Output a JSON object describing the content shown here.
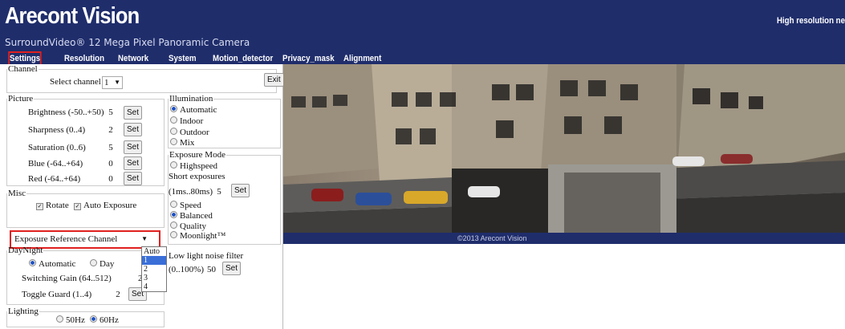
{
  "header": {
    "brand": "Arecont Vision",
    "subtitle": "SurroundVideo® 12 Mega Pixel Panoramic Camera",
    "right_text": "High resolution ne"
  },
  "nav": [
    "Settings",
    "Resolution",
    "Network",
    "System",
    "Motion_detector",
    "Privacy_mask",
    "Alignment"
  ],
  "channel": {
    "legend": "Channel",
    "label": "Select channel",
    "value": "1",
    "exit": "Exit"
  },
  "picture": {
    "legend": "Picture",
    "set": "Set",
    "rows": [
      {
        "label": "Brightness (-50..+50)",
        "value": "5"
      },
      {
        "label": "Sharpness (0..4)",
        "value": "2"
      },
      {
        "label": "Saturation (0..6)",
        "value": "5"
      },
      {
        "label": "Blue (-64..+64)",
        "value": "0"
      },
      {
        "label": "Red (-64..+64)",
        "value": "0"
      }
    ]
  },
  "misc": {
    "legend": "Misc",
    "rotate": "Rotate",
    "auto_exposure": "Auto Exposure",
    "exposure_ref": "Exposure Reference Channel",
    "dropdown_options": [
      "Auto",
      "1",
      "2",
      "3",
      "4"
    ]
  },
  "daynight": {
    "legend": "DayNight",
    "automatic": "Automatic",
    "day": "Day",
    "gain_label": "Switching Gain (64..512)",
    "gain_value": "25",
    "toggle_label": "Toggle Guard (1..4)",
    "toggle_value": "2",
    "set": "Set"
  },
  "lighting": {
    "legend": "Lighting",
    "hz50": "50Hz",
    "hz60": "60Hz"
  },
  "illumination": {
    "legend": "Illumination",
    "options": [
      "Automatic",
      "Indoor",
      "Outdoor",
      "Mix"
    ]
  },
  "exposure": {
    "legend": "Exposure Mode",
    "highspeed": "Highspeed",
    "short": "Short exposures",
    "range": "(1ms..80ms)",
    "range_value": "5",
    "set": "Set",
    "modes": [
      "Speed",
      "Balanced",
      "Quality",
      "Moonlight™"
    ]
  },
  "noise": {
    "label": "Low light noise filter",
    "range": "(0..100%)",
    "value": "50",
    "set": "Set"
  },
  "camera": {
    "caption": "©2013 Arecont Vision"
  },
  "colors": {
    "header_bg": "#1f2d6b",
    "highlight": "#e0201f",
    "radio_on": "#1b4fc4"
  }
}
